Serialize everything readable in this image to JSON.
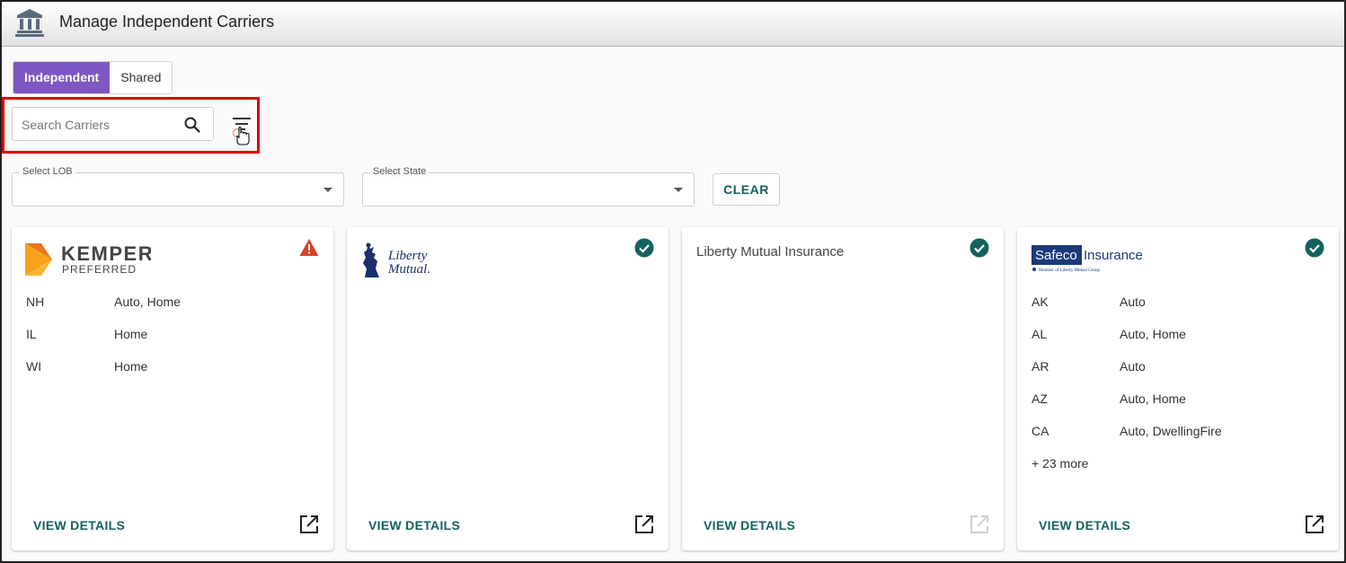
{
  "header": {
    "title": "Manage Independent Carriers",
    "icon": "bank-icon"
  },
  "tabs": [
    {
      "label": "Independent",
      "active": true
    },
    {
      "label": "Shared",
      "active": false
    }
  ],
  "search": {
    "placeholder": "Search Carriers",
    "value": ""
  },
  "filters": {
    "lob": {
      "label": "Select LOB",
      "value": ""
    },
    "state": {
      "label": "Select State",
      "value": ""
    },
    "clear_label": "CLEAR"
  },
  "cards": [
    {
      "logo": "kemper-preferred-logo",
      "logo_text": [
        "KEMPER",
        "PREFERRED"
      ],
      "status": "warning",
      "rows": [
        {
          "state": "NH",
          "lob": "Auto, Home"
        },
        {
          "state": "IL",
          "lob": "Home"
        },
        {
          "state": "WI",
          "lob": "Home"
        }
      ],
      "more": "",
      "view_label": "VIEW DETAILS",
      "link_enabled": true
    },
    {
      "logo": "liberty-mutual-logo",
      "logo_text": [
        "Liberty",
        "Mutual."
      ],
      "status": "ok",
      "rows": [],
      "more": "",
      "view_label": "VIEW DETAILS",
      "link_enabled": true
    },
    {
      "name": "Liberty Mutual Insurance",
      "status": "ok",
      "rows": [],
      "more": "",
      "view_label": "VIEW DETAILS",
      "link_enabled": false
    },
    {
      "logo": "safeco-insurance-logo",
      "logo_text": [
        "Safeco",
        "Insurance",
        "Member of Liberty Mutual Group"
      ],
      "status": "ok",
      "rows": [
        {
          "state": "AK",
          "lob": "Auto"
        },
        {
          "state": "AL",
          "lob": "Auto, Home"
        },
        {
          "state": "AR",
          "lob": "Auto"
        },
        {
          "state": "AZ",
          "lob": "Auto, Home"
        },
        {
          "state": "CA",
          "lob": "Auto, DwellingFire"
        }
      ],
      "more": "+ 23 more",
      "view_label": "VIEW DETAILS",
      "link_enabled": true
    }
  ],
  "colors": {
    "accent": "#7e57c2",
    "teal": "#13625f",
    "warning": "#d9412b",
    "highlight": "#e00000"
  }
}
